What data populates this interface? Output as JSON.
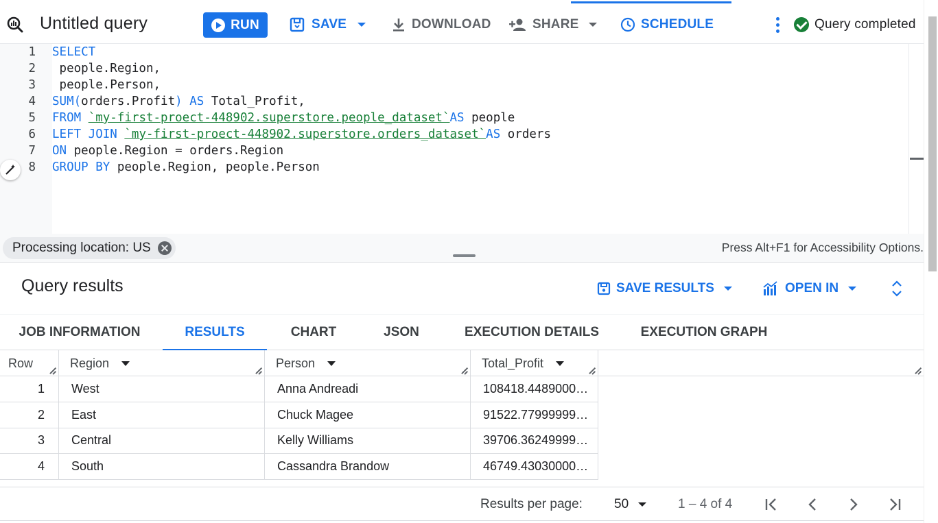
{
  "toolbar": {
    "title": "Untitled query",
    "run_label": "RUN",
    "save_label": "SAVE",
    "download_label": "DOWNLOAD",
    "share_label": "SHARE",
    "schedule_label": "SCHEDULE",
    "status": "Query completed"
  },
  "editor": {
    "line_numbers": [
      "1",
      "2",
      "3",
      "4",
      "5",
      "6",
      "7",
      "8"
    ],
    "lines": [
      {
        "kw1": "SELECT",
        "rest": ""
      },
      {
        "kw1": "",
        "rest": " people.Region,"
      },
      {
        "kw1": "",
        "rest": " people.Person,"
      },
      {
        "kw1": "SUM(",
        "mid": "orders.Profit",
        "kw2": ") AS",
        "rest": " Total_Profit,"
      },
      {
        "kw1": "FROM",
        "sp": " ",
        "str": "`my-first-proect-448902.superstore.people_dataset`",
        "kw2": "AS",
        "rest": " people"
      },
      {
        "kw1": "LEFT JOIN",
        "sp": " ",
        "str": "`my-first-proect-448902.superstore.orders_dataset`",
        "kw2": "AS",
        "rest": " orders"
      },
      {
        "kw1": "ON",
        "rest": " people.Region = orders.Region"
      },
      {
        "kw1": "GROUP BY",
        "rest": " people.Region, people.Person"
      }
    ]
  },
  "processing": {
    "location_label": "Processing location: US",
    "accessibility_hint": "Press Alt+F1 for Accessibility Options."
  },
  "results": {
    "title": "Query results",
    "save_results_label": "SAVE RESULTS",
    "open_in_label": "OPEN IN",
    "tabs": [
      "JOB INFORMATION",
      "RESULTS",
      "CHART",
      "JSON",
      "EXECUTION DETAILS",
      "EXECUTION GRAPH"
    ],
    "active_tab": "RESULTS",
    "columns": [
      "Row",
      "Region",
      "Person",
      "Total_Profit"
    ],
    "rows": [
      {
        "row": "1",
        "region": "West",
        "person": "Anna Andreadi",
        "profit": "108418.4489000…"
      },
      {
        "row": "2",
        "region": "East",
        "person": "Chuck Magee",
        "profit": "91522.77999999…"
      },
      {
        "row": "3",
        "region": "Central",
        "person": "Kelly Williams",
        "profit": "39706.36249999…"
      },
      {
        "row": "4",
        "region": "South",
        "person": "Cassandra Brandow",
        "profit": "46749.43030000…"
      }
    ]
  },
  "pagination": {
    "rpp_label": "Results per page:",
    "rpp_value": "50",
    "range": "1 – 4 of 4"
  },
  "colors": {
    "accent": "#1a73e8",
    "success": "#188038",
    "string": "#188038"
  }
}
